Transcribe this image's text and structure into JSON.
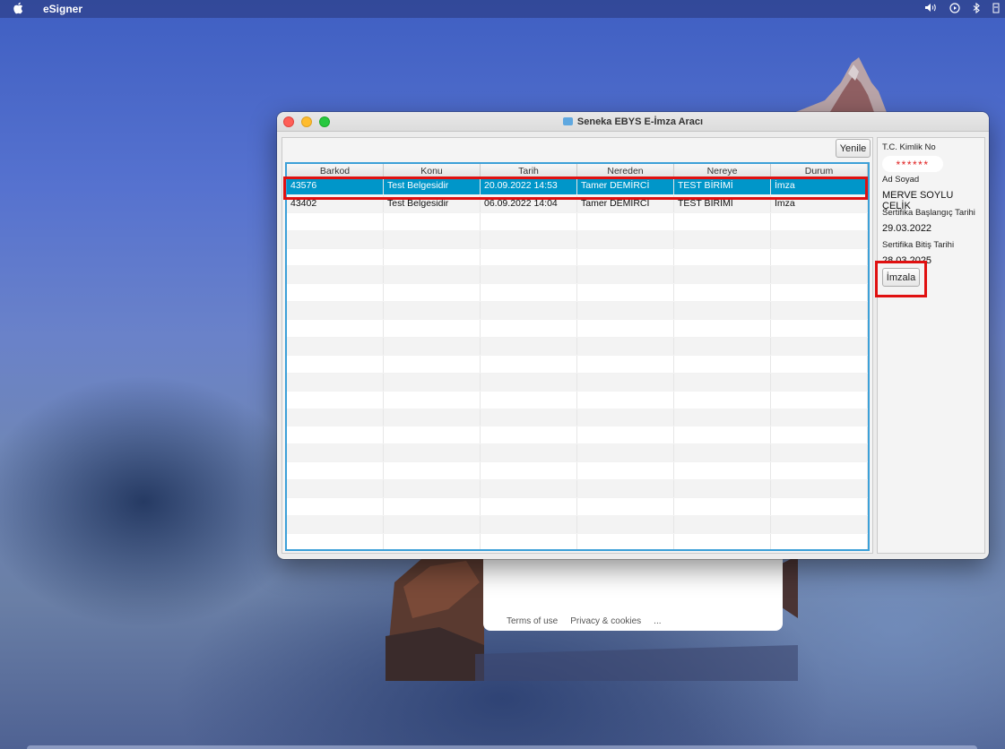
{
  "menubar": {
    "app_name": "eSigner",
    "status_icons": [
      "volume-icon",
      "play-icon",
      "bluetooth-icon",
      "battery-icon"
    ]
  },
  "background_panel": {
    "links": [
      "Terms of use",
      "Privacy & cookies",
      "..."
    ]
  },
  "window": {
    "title": "Seneka EBYS E-İmza Aracı",
    "refresh_label": "Yenile",
    "table": {
      "columns": [
        "Barkod",
        "Konu",
        "Tarih",
        "Nereden",
        "Nereye",
        "Durum"
      ],
      "rows": [
        [
          "43576",
          "Test Belgesidir",
          "20.09.2022 14:53",
          "Tamer DEMİRCİ",
          "TEST BİRİMİ",
          "İmza"
        ],
        [
          "43402",
          "Test Belgesidir",
          "06.09.2022 14:04",
          "Tamer DEMİRCİ",
          "TEST BİRİMİ",
          "İmza"
        ]
      ],
      "selected_row": 0
    },
    "info": {
      "tc_label": "T.C. Kimlik No",
      "tc_value": "******",
      "name_label": "Ad Soyad",
      "name_value": "MERVE SOYLU ÇELİK",
      "start_label": "Sertifika Başlangıç Tarihi",
      "start_value": "29.03.2022",
      "end_label": "Sertifika Bitiş Tarihi",
      "end_value": "28.03.2025",
      "sign_label": "İmzala"
    }
  },
  "colors": {
    "selection": "#0096c9",
    "annotation_red": "#e01010",
    "table_border": "#3ca0d8"
  }
}
